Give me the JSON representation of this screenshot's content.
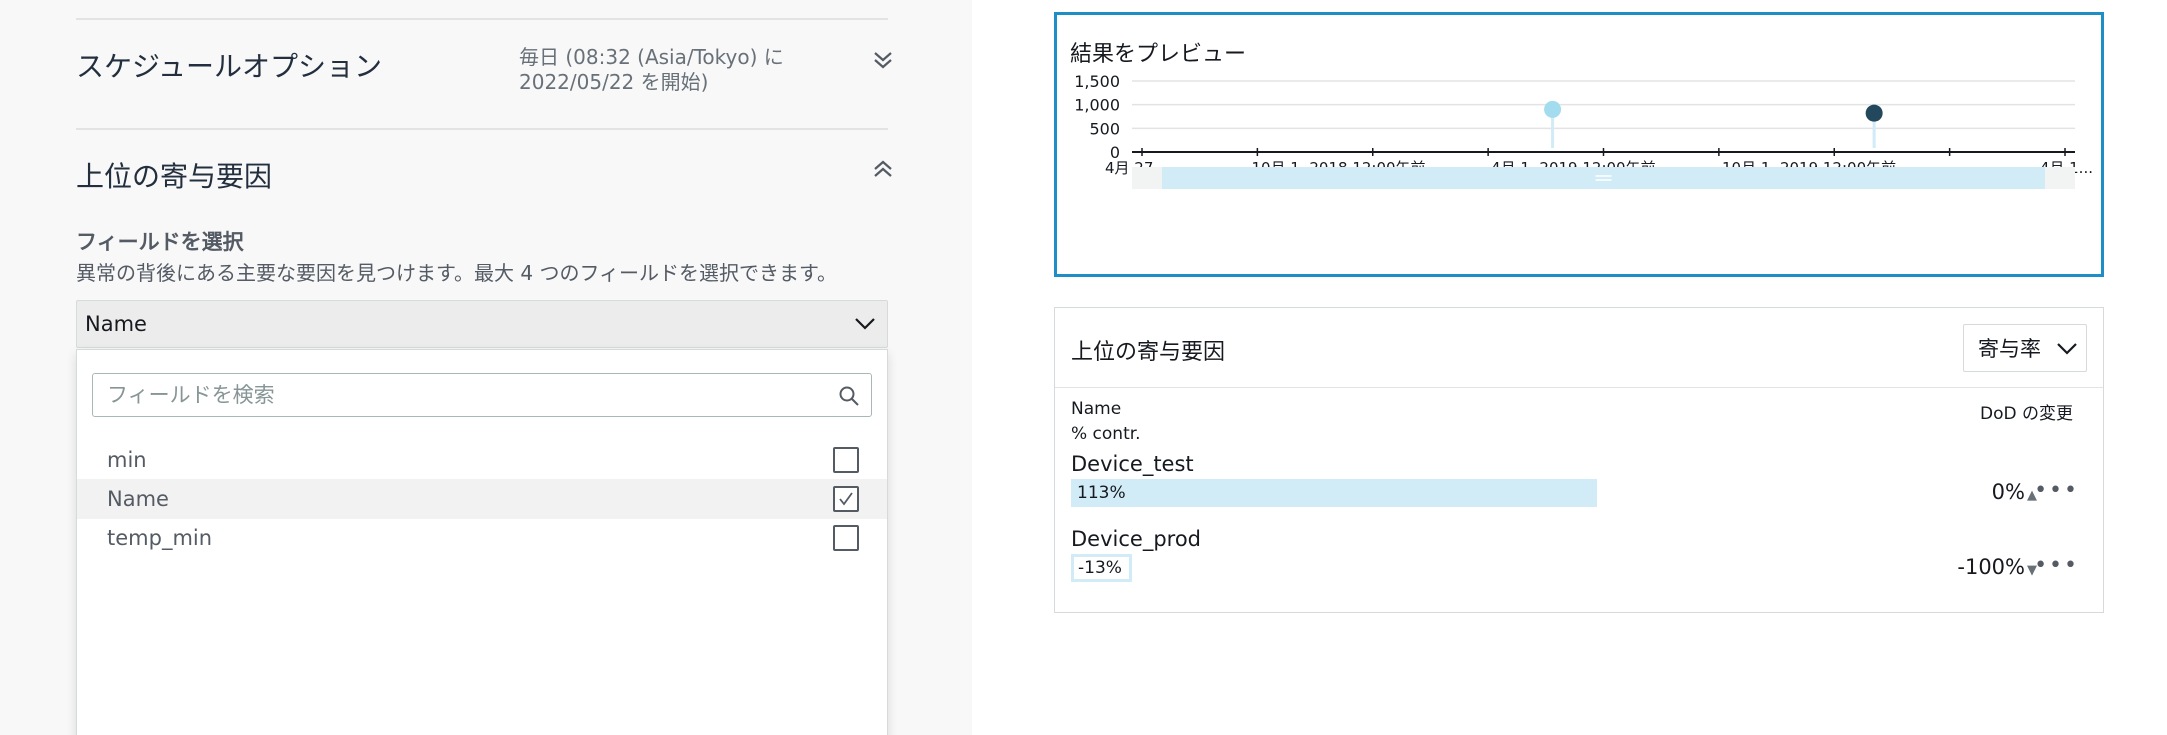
{
  "schedule": {
    "title": "スケジュールオプション",
    "summary_line1": "毎日 (08:32 (Asia/Tokyo) に",
    "summary_line2": "2022/05/22 を開始)"
  },
  "contributors_config": {
    "title": "上位の寄与要因",
    "field_label": "フィールドを選択",
    "field_desc": "異常の背後にある主要な要因を見つけます。最大 4 つのフィールドを選択できます。",
    "selected_value": "Name",
    "search_placeholder": "フィールドを検索",
    "options": [
      {
        "label": "min",
        "checked": false
      },
      {
        "label": "Name",
        "checked": true
      },
      {
        "label": "temp_min",
        "checked": false
      }
    ]
  },
  "preview": {
    "title": "結果をプレビュー"
  },
  "chart_data": {
    "type": "scatter",
    "title": "",
    "x_tick_labels": [
      "4月 27...",
      "10月 1, 2018 12:00午前",
      "4月 1, 2019 12:00午前",
      "10月 1, 2019 12:00午前",
      "4月 1..."
    ],
    "x_tick_positions": [
      0,
      0.219,
      0.468,
      0.718,
      1
    ],
    "y_ticks": [
      0,
      500,
      1000,
      1500
    ],
    "y_tick_labels": [
      "0",
      "500",
      "1,000",
      "1,500"
    ],
    "ylim": [
      0,
      1500
    ],
    "grid": true,
    "points": [
      {
        "x": 0.446,
        "y": 900,
        "color": "#a3dcee"
      },
      {
        "x": 0.787,
        "y": 820,
        "color": "#23485e"
      }
    ],
    "colors": {
      "axis": "#16191f",
      "grid": "#e3e3e3",
      "scrollbar": "#d1ebf7"
    }
  },
  "top_contributors": {
    "title": "上位の寄与要因",
    "sort_label": "寄与率",
    "col_name": "Name",
    "col_pct": "% contr.",
    "col_dod": "DoD の変更",
    "rows": [
      {
        "name": "Device_test",
        "pct_label": "113%",
        "bar_fraction": 0.56,
        "dod": "0%",
        "trend": "▲"
      },
      {
        "name": "Device_prod",
        "pct_label": "-13%",
        "bar_fraction": 0.065,
        "dod": "-100%",
        "trend": "▼"
      }
    ]
  }
}
